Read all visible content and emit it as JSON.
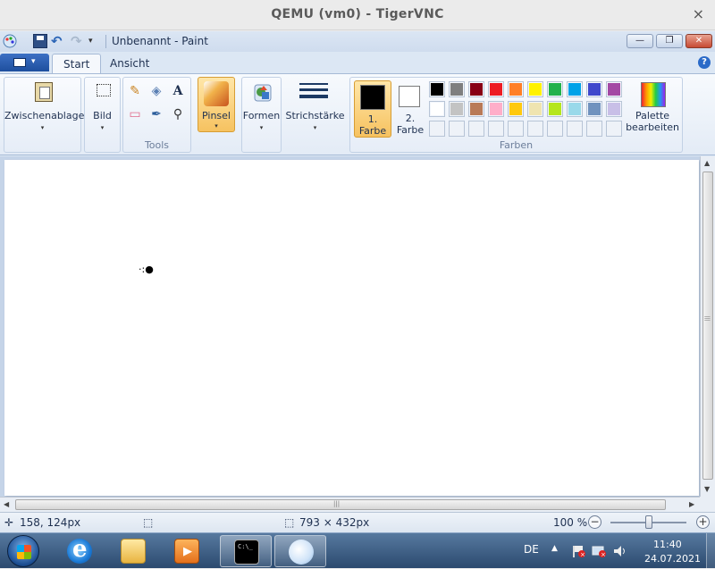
{
  "vnc": {
    "title": "QEMU (vm0) - TigerVNC",
    "close_glyph": "×"
  },
  "paint": {
    "doc_title": "Unbenannt - Paint",
    "qat_menu_glyph": "▾",
    "undo_glyph": "↶",
    "redo_glyph": "↷",
    "window_buttons": {
      "min": "—",
      "max": "❐",
      "close": "✕"
    }
  },
  "tabs": {
    "start": "Start",
    "ansicht": "Ansicht",
    "help": "?"
  },
  "ribbon": {
    "clipboard_label": "Zwischenablage",
    "image_label": "Bild",
    "tools_group_label": "Tools",
    "brush_label": "Pinsel",
    "shapes_label": "Formen",
    "stroke_label": "Strichstärke",
    "color1_label_line1": "1.",
    "color1_label_line2": "Farbe",
    "color2_label_line1": "2.",
    "color2_label_line2": "Farbe",
    "colors_group_label": "Farben",
    "palette_label_line1": "Palette",
    "palette_label_line2": "bearbeiten",
    "dropdown_glyph": "▾",
    "tools": {
      "pencil_glyph": "✎",
      "fill_glyph": "◈",
      "text_glyph": "A",
      "eraser_glyph": "▭",
      "picker_glyph": "✒",
      "magnifier_glyph": "⚲"
    },
    "color1": "#000000",
    "color2": "#ffffff",
    "palette_row1": [
      "#000000",
      "#7f7f7f",
      "#880015",
      "#ed1c24",
      "#ff7f27",
      "#fff200",
      "#22b14c",
      "#00a2e8",
      "#3f48cc",
      "#a349a4"
    ],
    "palette_row2": [
      "#ffffff",
      "#c3c3c3",
      "#b97a57",
      "#ffaec9",
      "#ffc90e",
      "#efe4b0",
      "#b5e61d",
      "#99d9ea",
      "#7092be",
      "#c8bfe7"
    ],
    "palette_row3_count_empty": 10
  },
  "canvas": {
    "cursor_glyph": "·:●"
  },
  "scrollbars": {
    "up": "▲",
    "down": "▼",
    "left": "◀",
    "right": "▶",
    "grip": "|||"
  },
  "status": {
    "position_glyph": "✛",
    "position": "158, 124px",
    "selection_glyph": "⬚",
    "size_glyph": "⬚",
    "size": "793 × 432px",
    "zoom": "100 %",
    "zoom_minus": "−",
    "zoom_plus": "+",
    "zoom_level": 1.0
  },
  "taskbar": {
    "language": "DE",
    "tray_arrow": "▲",
    "time": "11:40",
    "date": "24.07.2021"
  }
}
